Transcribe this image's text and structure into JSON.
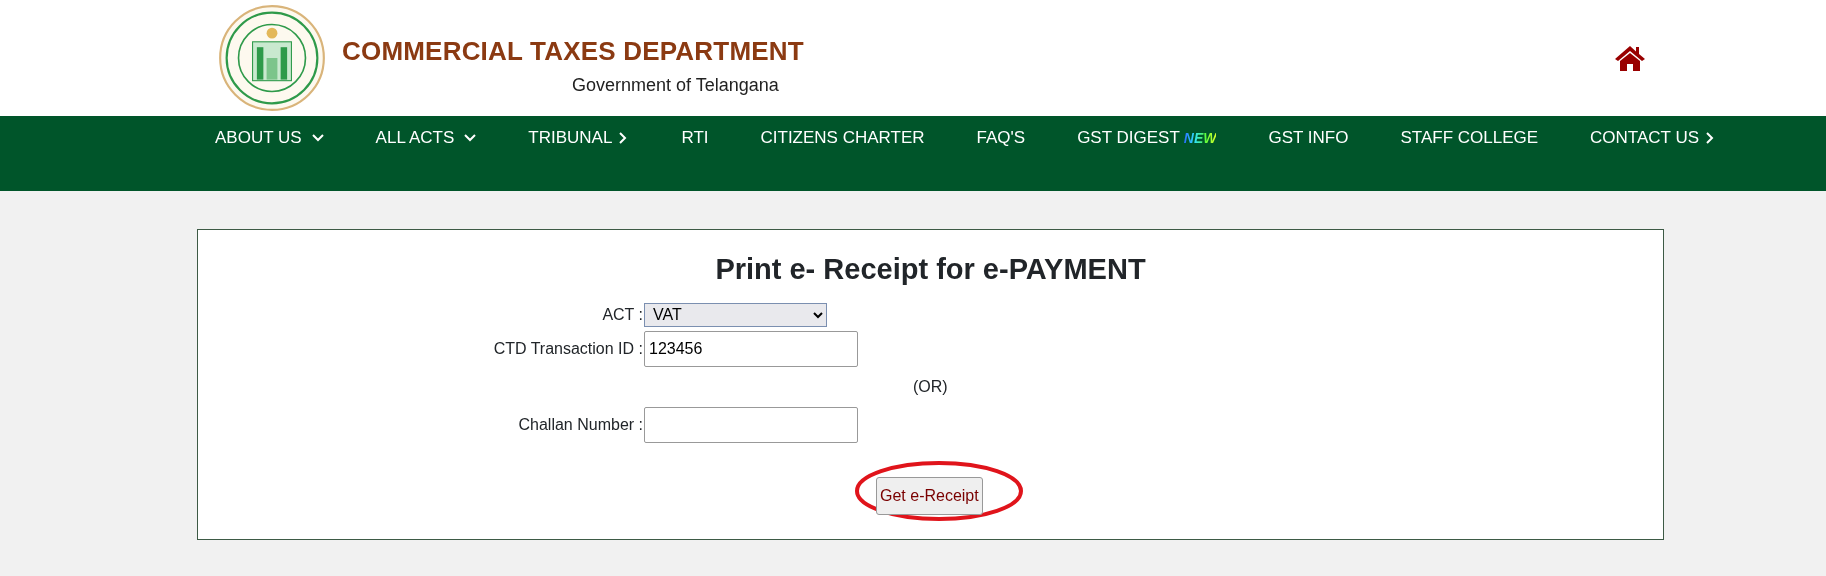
{
  "header": {
    "title": "COMMERCIAL TAXES DEPARTMENT",
    "subtitle": "Government of Telangana"
  },
  "nav": [
    {
      "label": "ABOUT US",
      "kind": "dropdown"
    },
    {
      "label": "ALL ACTS",
      "kind": "dropdown"
    },
    {
      "label": "TRIBUNAL",
      "kind": "submenu"
    },
    {
      "label": "RTI",
      "kind": "link"
    },
    {
      "label": "CITIZENS CHARTER",
      "kind": "link"
    },
    {
      "label": "FAQ'S",
      "kind": "link"
    },
    {
      "label": "GST DIGEST",
      "kind": "link",
      "badge": "NEW"
    },
    {
      "label": "GST INFO",
      "kind": "link"
    },
    {
      "label": "STAFF COLLEGE",
      "kind": "link"
    },
    {
      "label": "CONTACT US",
      "kind": "submenu"
    }
  ],
  "form": {
    "title": "Print e- Receipt for e-PAYMENT",
    "fields": [
      {
        "kind": "select",
        "label": "ACT :",
        "value": "VAT"
      },
      {
        "kind": "text",
        "label": "CTD Transaction ID :",
        "value": "123456"
      },
      {
        "kind": "separator",
        "label": "(OR)"
      },
      {
        "kind": "text",
        "label": "Challan Number :"
      }
    ],
    "button": {
      "label": "Get e-Receipt",
      "circled": true
    }
  }
}
